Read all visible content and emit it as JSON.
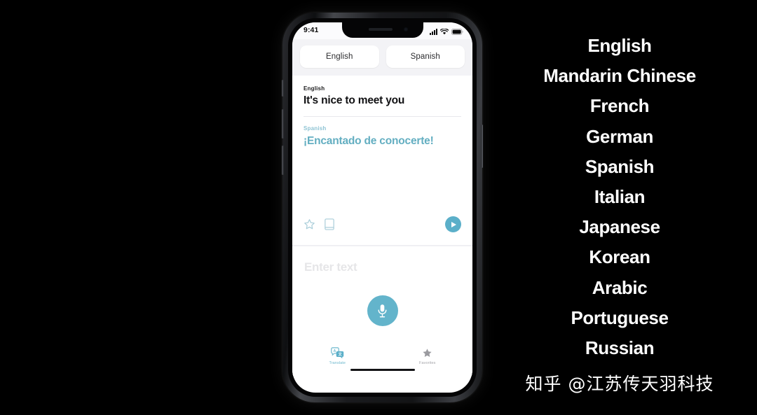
{
  "theme": {
    "background": "#000000",
    "accent_teal": "#5BAFC9",
    "accent_teal_light": "#7EC3D6",
    "screen_white": "#FFFFFF",
    "selector_gray": "#F3F3F6",
    "placeholder_gray": "#E6E6E8",
    "tab_inactive_gray": "#9A9A9F"
  },
  "phone": {
    "status_bar": {
      "time": "9:41",
      "signal_icon": "cellular-signal-icon",
      "wifi_icon": "wifi-icon",
      "battery_icon": "battery-icon"
    },
    "language_selector": {
      "source_language": "English",
      "target_language": "Spanish"
    },
    "translation_card": {
      "source_label": "English",
      "source_text": "It's nice to meet you",
      "target_label": "Spanish",
      "target_text": "¡Encantado de conocerte!",
      "actions": {
        "favorite_icon": "star-outline-icon",
        "dictionary_icon": "dictionary-book-icon",
        "play_icon": "play-circle-icon"
      }
    },
    "input_area": {
      "placeholder": "Enter text",
      "mic_icon": "microphone-icon"
    },
    "tab_bar": {
      "tabs": [
        {
          "label": "Translate",
          "icon": "translate-bubbles-icon",
          "active": true
        },
        {
          "label": "Favorites",
          "icon": "star-filled-icon",
          "active": false
        }
      ]
    }
  },
  "language_list": {
    "items": [
      "English",
      "Mandarin Chinese",
      "French",
      "German",
      "Spanish",
      "Italian",
      "Japanese",
      "Korean",
      "Arabic",
      "Portuguese",
      "Russian"
    ]
  },
  "watermark": {
    "text": "知乎 @江苏传天羽科技"
  }
}
